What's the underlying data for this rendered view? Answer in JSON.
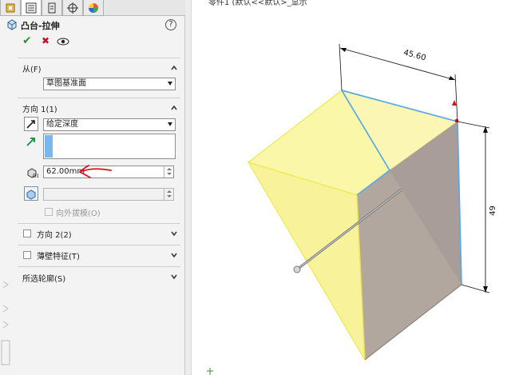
{
  "property_manager": {
    "title": "凸台-拉伸",
    "tabs": [
      "feature-manager-icon",
      "property-manager-icon",
      "configuration-manager-icon",
      "dimxpert-icon",
      "display-manager-icon"
    ],
    "actions": {
      "ok": "✔",
      "cancel": "✖",
      "preview": "👁"
    },
    "from": {
      "label": "从(F)",
      "value": "草图基准面"
    },
    "direction1": {
      "label": "方向 1(1)",
      "end_condition": "给定深度",
      "depth": "62.00mm",
      "draft_outward_label": "向外拔模(O)"
    },
    "direction2": {
      "label": "方向 2(2)"
    },
    "thin_feature": {
      "label": "薄壁特征(T)"
    },
    "selected_contours": {
      "label": "所选轮廓(S)"
    }
  },
  "viewport": {
    "title_fragment": "零件1 (默认<<默认>_显示",
    "dimension_width": "45.60",
    "dimension_height": "49",
    "colors": {
      "face": "#f6f47a",
      "edge_selected": "#5aa8e6",
      "annotation": "#d0141c"
    }
  }
}
